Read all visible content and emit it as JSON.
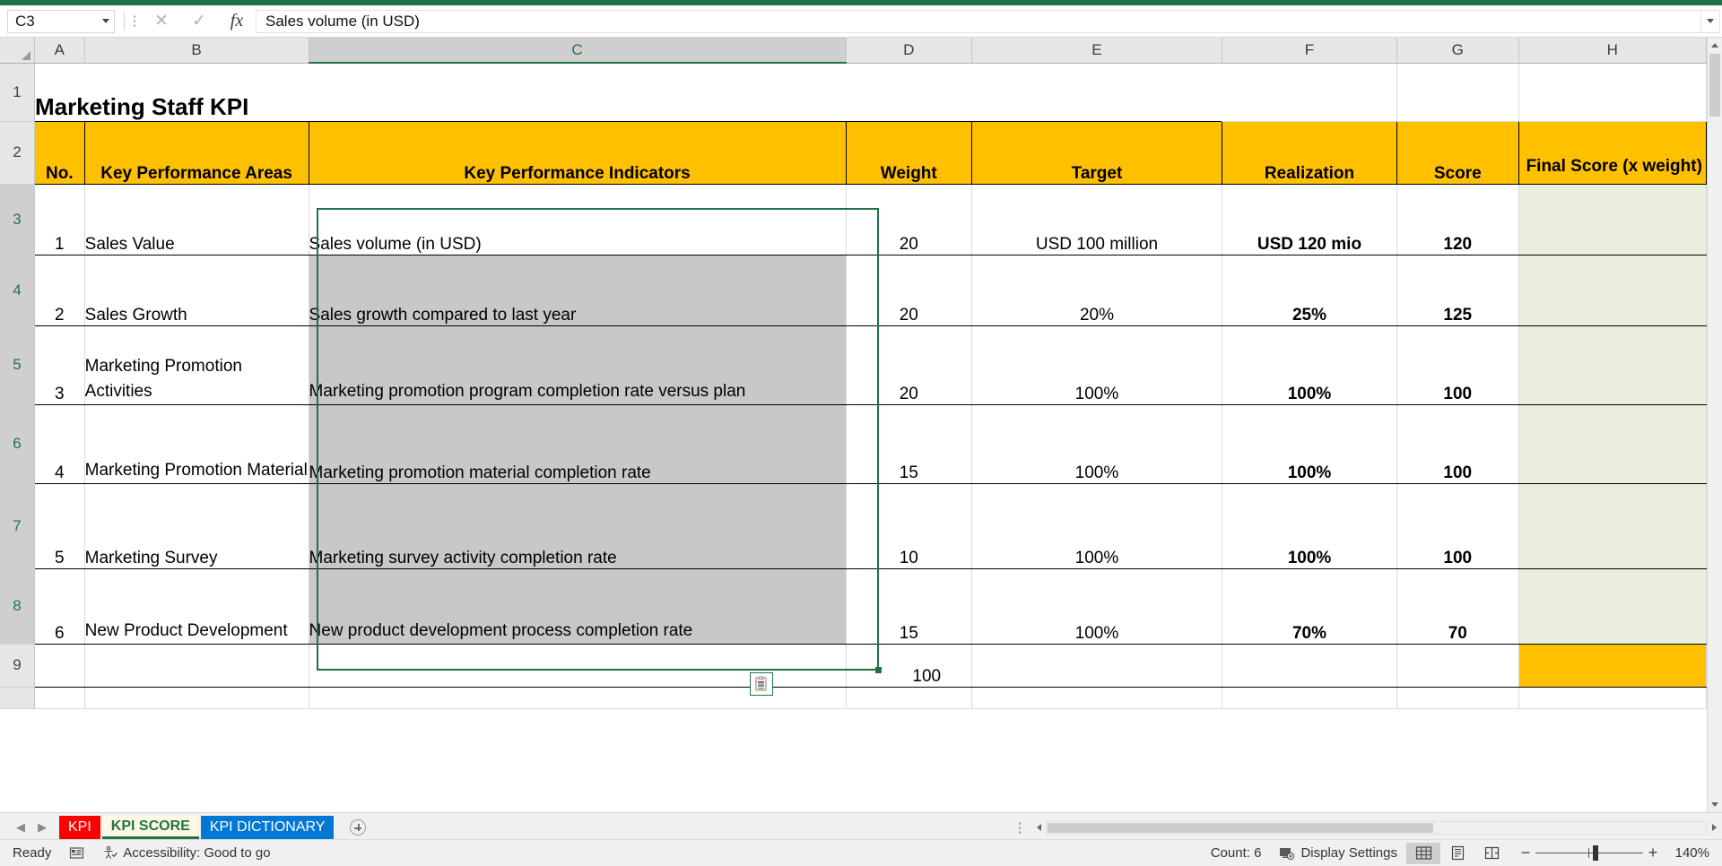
{
  "formula_bar": {
    "name_box_value": "C3",
    "formula_value": "Sales volume (in USD)",
    "cancel_icon": "close-icon",
    "enter_icon": "check-icon",
    "function_icon": "fx-icon"
  },
  "grid": {
    "column_headers": [
      "A",
      "B",
      "C",
      "D",
      "E",
      "F",
      "G",
      "H"
    ],
    "selected_column": "C",
    "row_headers": [
      "1",
      "2",
      "3",
      "4",
      "5",
      "6",
      "7",
      "8",
      "9"
    ],
    "title": "Marketing Staff KPI",
    "table_headers": {
      "no": "No.",
      "areas": "Key Performance Areas",
      "indicators": "Key Performance Indicators",
      "weight": "Weight",
      "target": "Target",
      "realization": "Realization",
      "score": "Score",
      "final_score": "Final Score (x weight)"
    },
    "rows": [
      {
        "row": "3",
        "no": "1",
        "area": "Sales Value",
        "indicator": "Sales volume (in USD)",
        "weight": "20",
        "target": "USD 100 million",
        "realization": "USD 120 mio",
        "score": "120",
        "final": ""
      },
      {
        "row": "4",
        "no": "2",
        "area": "Sales Growth",
        "indicator": "Sales growth compared to last year",
        "weight": "20",
        "target": "20%",
        "realization": "25%",
        "score": "125",
        "final": ""
      },
      {
        "row": "5",
        "no": "3",
        "area": "Marketing Promotion Activities",
        "indicator": "Marketing promotion program completion rate versus plan",
        "weight": "20",
        "target": "100%",
        "realization": "100%",
        "score": "100",
        "final": ""
      },
      {
        "row": "6",
        "no": "4",
        "area": "Marketing Promotion Material",
        "indicator": "Marketing promotion material completion rate",
        "weight": "15",
        "target": "100%",
        "realization": "100%",
        "score": "100",
        "final": ""
      },
      {
        "row": "7",
        "no": "5",
        "area": "Marketing Survey",
        "indicator": "Marketing survey activity completion rate",
        "weight": "10",
        "target": "100%",
        "realization": "100%",
        "score": "100",
        "final": ""
      },
      {
        "row": "8",
        "no": "6",
        "area": "New Product Development",
        "indicator": "New product development process completion rate",
        "weight": "15",
        "target": "100%",
        "realization": "70%",
        "score": "70",
        "final": ""
      }
    ],
    "total_row": {
      "row": "9",
      "weight_total": "100"
    },
    "paste_options_icon": "paste-options-icon",
    "colors": {
      "header_fill": "#FFC000",
      "selection_fill": "#C8C8C8",
      "final_score_fill": "#EAEFDD",
      "selection_border": "#217346"
    }
  },
  "sheet_tabs": {
    "prev_icon": "chevron-left-icon",
    "next_icon": "chevron-right-icon",
    "tabs": [
      {
        "label": "KPI",
        "color": "#FF0000",
        "active": false
      },
      {
        "label": "KPI SCORE",
        "color": "#FDF7E3",
        "active": true
      },
      {
        "label": "KPI DICTIONARY",
        "color": "#0078D4",
        "active": false
      }
    ],
    "add_sheet_icon": "plus-circle-icon",
    "tab_options_icon": "ellipsis-icon"
  },
  "status_bar": {
    "mode": "Ready",
    "macro_icon": "record-macro-icon",
    "accessibility_icon": "accessibility-icon",
    "accessibility": "Accessibility: Good to go",
    "count": "Count: 6",
    "display_settings_icon": "display-settings-icon",
    "display_settings": "Display Settings",
    "view_normal_icon": "normal-view-icon",
    "view_pagelayout_icon": "page-layout-view-icon",
    "view_pagebreak_icon": "page-break-view-icon",
    "zoom_out_icon": "zoom-out-icon",
    "zoom_in_icon": "zoom-in-icon",
    "zoom_level": "140%"
  }
}
